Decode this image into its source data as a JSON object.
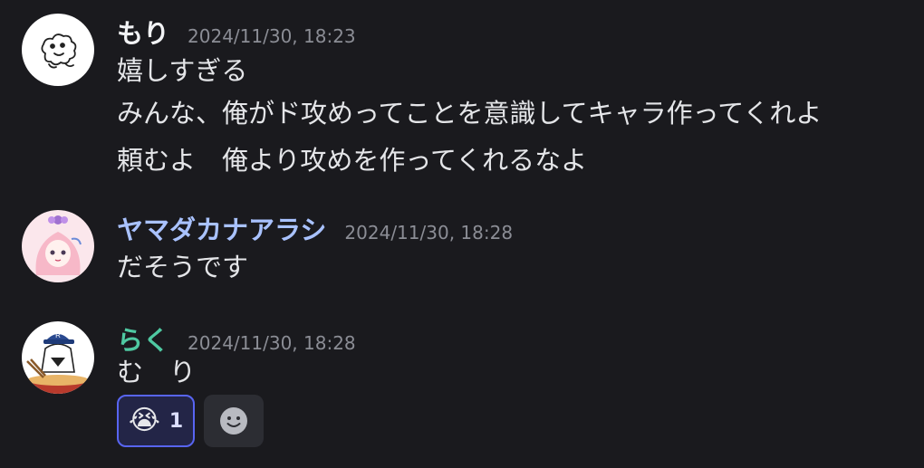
{
  "messages": [
    {
      "author": "もり",
      "author_color": "#f2f3f5",
      "timestamp": "2024/11/30, 18:23",
      "avatar_icon": "doodle-avatar",
      "lines": [
        "嬉しすぎる",
        "みんな、俺がド攻めってことを意識してキャラ作ってくれよ",
        "頼むよ　俺より攻めを作ってくれるなよ"
      ]
    },
    {
      "author": "ヤマダカナアラシ",
      "author_color": "#a9c2ff",
      "timestamp": "2024/11/30, 18:28",
      "avatar_icon": "anime-girl-avatar",
      "lines": [
        "だそうです"
      ]
    },
    {
      "author": "らく",
      "author_color": "#4fc9a2",
      "timestamp": "2024/11/30, 18:28",
      "avatar_icon": "cap-character-avatar",
      "lines": [
        "む　り"
      ],
      "reactions": [
        {
          "emoji": "😭",
          "count": "1",
          "reacted_by_me": true
        }
      ],
      "add_reaction_icon": "smiley-face-icon"
    }
  ],
  "colors": {
    "background": "#1a1a1e",
    "timestamp": "#8b8d95",
    "reaction_active_bg": "#232547",
    "reaction_active_border": "#5865f2",
    "add_reaction_bg": "#2c2d33"
  }
}
